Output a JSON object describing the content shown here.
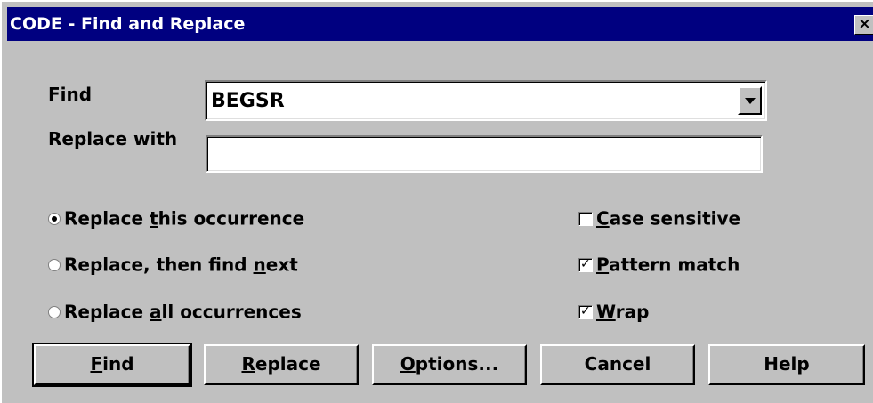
{
  "window": {
    "title": "CODE - Find and Replace",
    "close_label": "×"
  },
  "find": {
    "label": "Find",
    "value": "BEGSR"
  },
  "replace": {
    "label": "Replace with",
    "value": ""
  },
  "radios": [
    {
      "pre": "Replace ",
      "mn": "t",
      "post": "his occurrence",
      "checked": true
    },
    {
      "pre": "Replace, then find ",
      "mn": "n",
      "post": "ext",
      "checked": false
    },
    {
      "pre": "Replace ",
      "mn": "a",
      "post": "ll occurrences",
      "checked": false
    }
  ],
  "checks": [
    {
      "pre": "",
      "mn": "C",
      "post": "ase sensitive",
      "checked": false
    },
    {
      "pre": "",
      "mn": "P",
      "post": "attern match",
      "checked": true
    },
    {
      "pre": "",
      "mn": "W",
      "post": "rap",
      "checked": true
    }
  ],
  "buttons": {
    "find": {
      "mn": "F",
      "post": "ind"
    },
    "replace": {
      "mn": "R",
      "post": "eplace"
    },
    "options": {
      "mn": "O",
      "post": "ptions..."
    },
    "cancel": {
      "label": "Cancel"
    },
    "help": {
      "label": "Help"
    }
  }
}
